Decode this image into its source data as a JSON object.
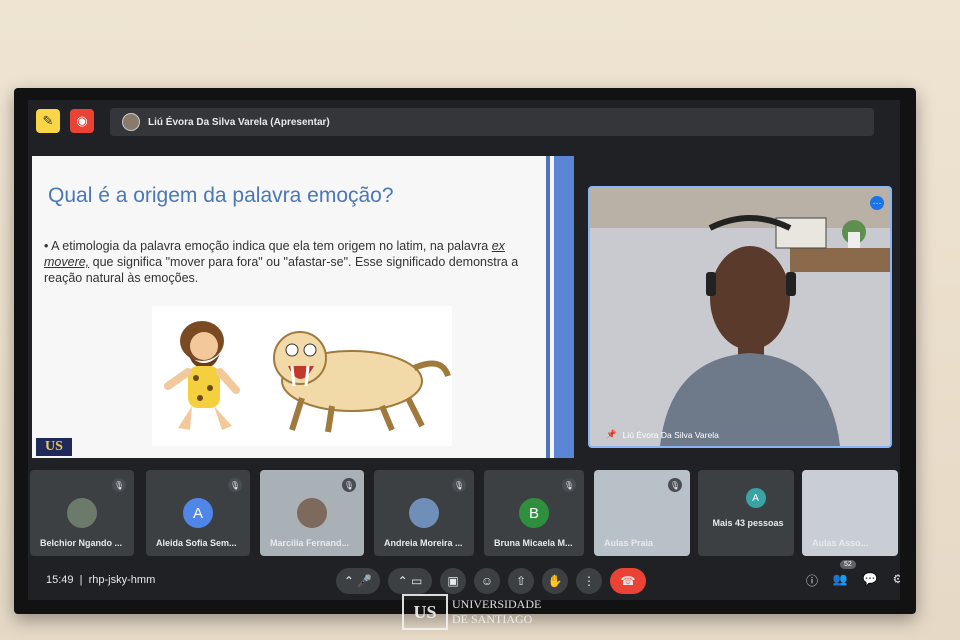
{
  "meeting": {
    "presenter_label": "Liú Évora Da Silva Varela (Apresentar)",
    "time": "15:49",
    "code": "rhp-jsky-hmm",
    "participants_badge": "52"
  },
  "slide": {
    "title": "Qual é a origem da palavra emoção?",
    "bullet_1": "A etimologia da palavra emoção indica que ela tem origem no latim, na palavra",
    "bullet_emph": "ex movere,",
    "bullet_2": "que significa \"mover para fora\" ou \"afastar-se\". Esse significado demonstra a reação natural às emoções.",
    "logo": "US"
  },
  "speaker": {
    "name": "Liú Évora Da Silva Varela"
  },
  "tiles": [
    {
      "name": "Belchior Ngando ...",
      "initial": "",
      "color": "#6b7a6b"
    },
    {
      "name": "Aleida Sofia Sem...",
      "initial": "A",
      "color": "#4f86e8"
    },
    {
      "name": "Marcilia Fernand...",
      "initial": "",
      "color": "#9aa3ad"
    },
    {
      "name": "Andreia Moreira ...",
      "initial": "",
      "color": "#6f8fb8"
    },
    {
      "name": "Bruna Micaela M...",
      "initial": "B",
      "color": "#2f8f3f"
    },
    {
      "name": "Aulas Praia",
      "initial": "",
      "color": "#b8c0c8"
    },
    {
      "name": "Mais 43 pessoas",
      "initial": "A",
      "color": "#3aa3a3"
    },
    {
      "name": "Aulas Asso...",
      "initial": "",
      "color": "#c8ced4"
    }
  ],
  "controls": {
    "labels": [
      "^",
      "mic-icon",
      "^",
      "camera-icon",
      "cc-icon",
      "emoji-icon",
      "present-icon",
      "hand-icon",
      "more-icon",
      "hangup-icon"
    ]
  },
  "watermark": {
    "line1": "UNIVERSIDADE",
    "line2": "DE SANTIAGO",
    "logo": "US"
  }
}
